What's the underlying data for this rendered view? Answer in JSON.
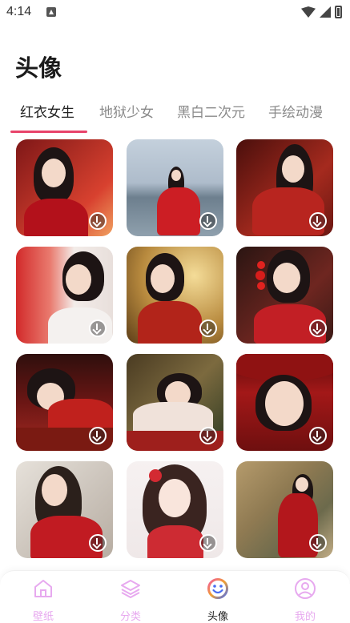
{
  "status_bar": {
    "time": "4:14"
  },
  "page": {
    "title": "头像"
  },
  "tabs": [
    {
      "label": "红衣女生",
      "active": true
    },
    {
      "label": "地狱少女",
      "active": false
    },
    {
      "label": "黑白二次元",
      "active": false
    },
    {
      "label": "手绘动漫",
      "active": false
    }
  ],
  "grid": {
    "items": [
      {
        "subject": "woman-in-red-with-lantern",
        "palette": [
          "#8e1b1b",
          "#d8412f"
        ]
      },
      {
        "subject": "woman-in-red-by-lake",
        "palette": [
          "#9fb3c7",
          "#c9d2d9"
        ]
      },
      {
        "subject": "woman-in-red-hanfu-sitting",
        "palette": [
          "#5a1410",
          "#b93122"
        ]
      },
      {
        "subject": "woman-with-red-ribbons",
        "palette": [
          "#e9d6cf",
          "#cf2d2d"
        ]
      },
      {
        "subject": "woman-in-golden-light",
        "palette": [
          "#b88a3e",
          "#e1c27a"
        ]
      },
      {
        "subject": "woman-with-candied-haws",
        "palette": [
          "#3a1d1a",
          "#8e2b24"
        ]
      },
      {
        "subject": "woman-lying-on-table",
        "palette": [
          "#3d1210",
          "#a72421"
        ]
      },
      {
        "subject": "woman-reclining-in-hanfu",
        "palette": [
          "#4a3b22",
          "#7c6a3f"
        ]
      },
      {
        "subject": "woman-with-red-hat",
        "palette": [
          "#6e0f0f",
          "#b01c1c"
        ]
      },
      {
        "subject": "woman-with-long-hair-red-dress",
        "palette": [
          "#c9c1b8",
          "#e5dfd8"
        ]
      },
      {
        "subject": "illustrated-girl-with-flowers",
        "palette": [
          "#efe8e8",
          "#f6f1f1"
        ]
      },
      {
        "subject": "woman-in-front-of-mural",
        "palette": [
          "#a88b5c",
          "#6c6a4c"
        ]
      }
    ]
  },
  "bottom_nav": {
    "items": [
      {
        "label": "壁纸",
        "icon": "home-icon",
        "active": false
      },
      {
        "label": "分类",
        "icon": "layers-icon",
        "active": false
      },
      {
        "label": "头像",
        "icon": "smile-icon",
        "active": true
      },
      {
        "label": "我的",
        "icon": "user-icon",
        "active": false
      }
    ]
  },
  "colors": {
    "accent": "#e8436a",
    "nav_inactive": "#e7a9ef",
    "text_primary": "#222222",
    "text_secondary": "#8a8a8a"
  }
}
